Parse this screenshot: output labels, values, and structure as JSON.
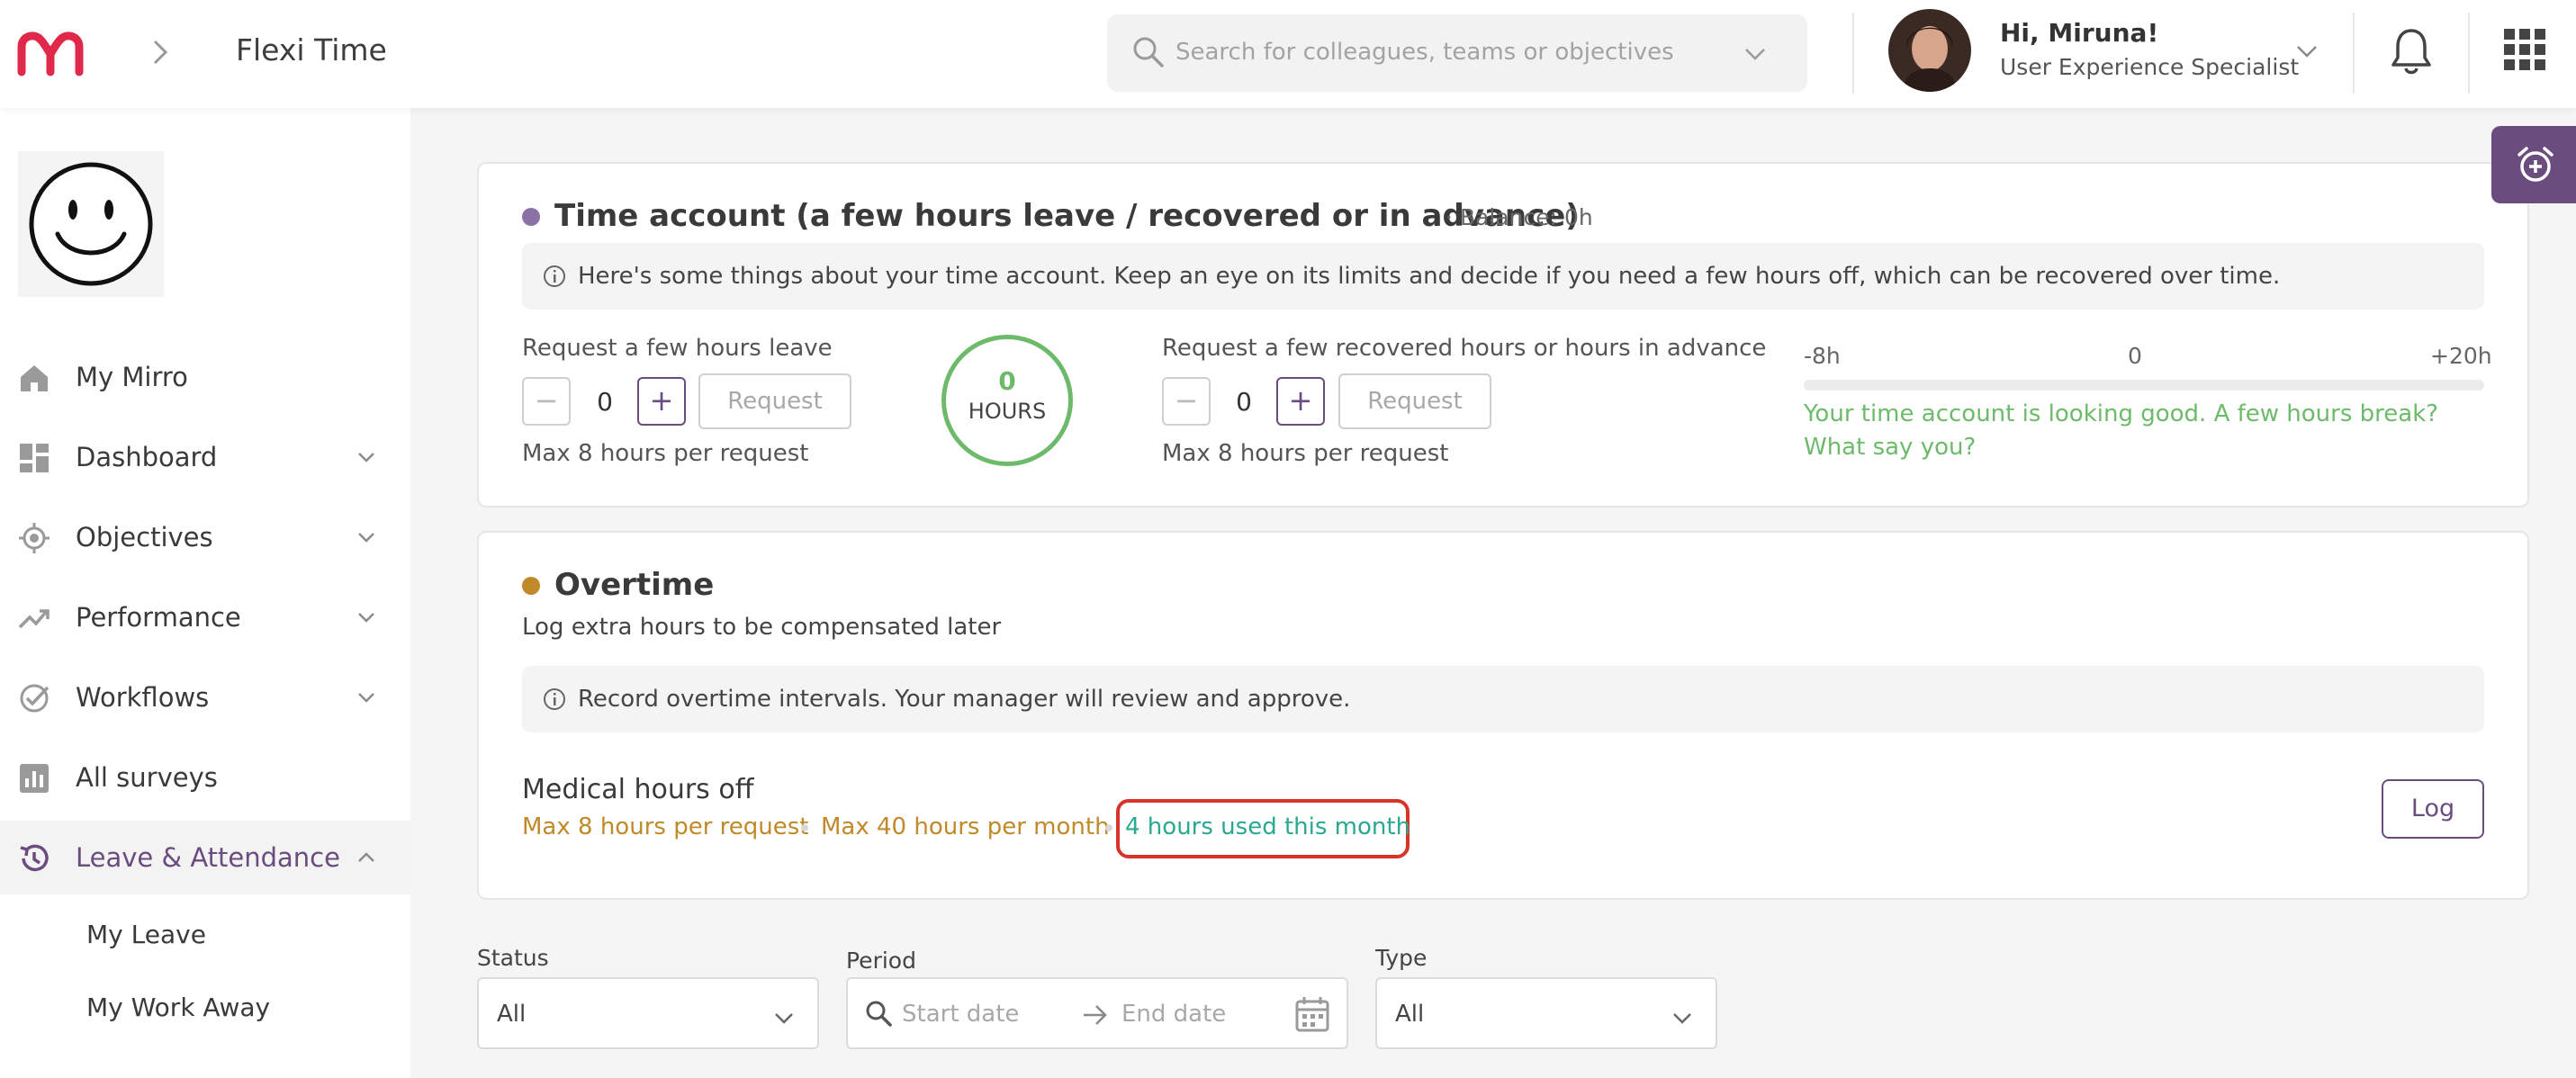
{
  "header": {
    "title": "Flexi Time",
    "search_placeholder": "Search for colleagues, teams or objectives",
    "user_greeting": "Hi, Miruna!",
    "user_role": "User Experience Specialist"
  },
  "colors": {
    "brand": "#e0284a",
    "accent": "#6a4c7e",
    "success": "#6dbb6a",
    "warning": "#c08a2a",
    "teal": "#2aa890",
    "highlight": "#d8342a"
  },
  "sidebar": {
    "items": [
      {
        "label": "My Mirro",
        "icon": "home-icon"
      },
      {
        "label": "Dashboard",
        "icon": "dashboard-icon"
      },
      {
        "label": "Objectives",
        "icon": "target-icon"
      },
      {
        "label": "Performance",
        "icon": "trend-icon"
      },
      {
        "label": "Workflows",
        "icon": "check-circle-icon"
      },
      {
        "label": "All surveys",
        "icon": "bar-chart-icon"
      },
      {
        "label": "Leave & Attendance",
        "icon": "history-icon"
      }
    ],
    "subitems": [
      "My Leave",
      "My Work Away"
    ]
  },
  "time_account": {
    "title": "Time account (a few hours leave / recovered or in advance)",
    "balance": "· Balance: 0h",
    "info": "Here's some things about your time account. Keep an eye on its limits and decide if you need a few hours off, which can be recovered over time.",
    "leave": {
      "label": "Request a few hours leave",
      "minus": "−",
      "plus": "+",
      "value": "0",
      "button": "Request",
      "note": "Max 8 hours per request"
    },
    "ring": {
      "value": "0",
      "unit": "HOURS"
    },
    "recover": {
      "label": "Request a few recovered hours or hours in advance",
      "minus": "−",
      "plus": "+",
      "value": "0",
      "button": "Request",
      "note": "Max 8 hours per request"
    },
    "scale": {
      "min": "-8h",
      "mid": "0",
      "max": "+20h"
    },
    "status": "Your time account is looking good. A few hours break? What say you?"
  },
  "overtime": {
    "title": "Overtime",
    "subtitle": "Log extra hours to be compensated later",
    "info": "Record overtime intervals. Your manager will review and approve.",
    "medical": {
      "title": "Medical hours off",
      "max_request": "Max 8 hours per request",
      "max_month": "Max 40 hours per month",
      "used": "4 hours used this month",
      "button": "Log"
    }
  },
  "filters": {
    "status": {
      "label": "Status",
      "value": "All"
    },
    "period": {
      "label": "Period",
      "start": "Start date",
      "end": "End date"
    },
    "type": {
      "label": "Type",
      "value": "All"
    }
  }
}
